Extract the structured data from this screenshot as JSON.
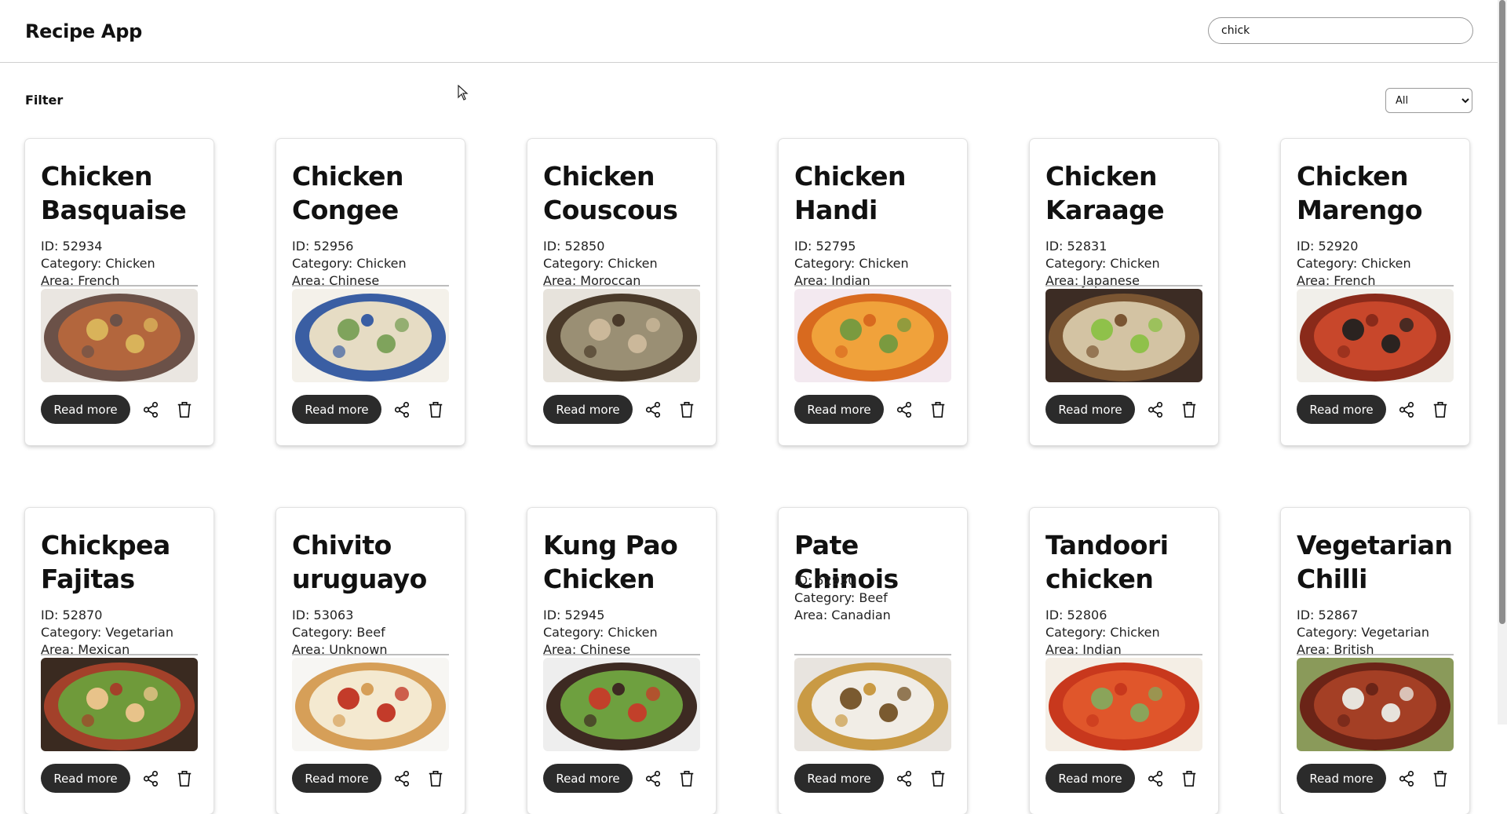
{
  "app": {
    "title": "Recipe App"
  },
  "search": {
    "value": "chick",
    "placeholder": ""
  },
  "filter": {
    "label": "Filter",
    "selected": "All",
    "options": [
      "All"
    ]
  },
  "recipes": [
    {
      "name": "Chicken Basquaise",
      "id": "ID: 52934",
      "category": "Category: Chicken",
      "area": "Area: French",
      "read_more": "Read more",
      "palette": [
        "#6b5148",
        "#b3663d",
        "#d9b35a",
        "#eae6e1"
      ]
    },
    {
      "name": "Chicken Congee",
      "id": "ID: 52956",
      "category": "Category: Chicken",
      "area": "Area: Chinese",
      "read_more": "Read more",
      "palette": [
        "#3a5ea3",
        "#e6dcc4",
        "#7fa35c",
        "#f4f1ea"
      ]
    },
    {
      "name": "Chicken Couscous",
      "id": "ID: 52850",
      "category": "Category: Chicken",
      "area": "Area: Moroccan",
      "read_more": "Read more",
      "palette": [
        "#4a3a2a",
        "#9a8f74",
        "#cbb89a",
        "#e7e3dc"
      ]
    },
    {
      "name": "Chicken Handi",
      "id": "ID: 52795",
      "category": "Category: Chicken",
      "area": "Area: Indian",
      "read_more": "Read more",
      "palette": [
        "#d86a1f",
        "#f0a23b",
        "#7a9a3f",
        "#f3e9f0"
      ]
    },
    {
      "name": "Chicken Karaage",
      "id": "ID: 52831",
      "category": "Category: Chicken",
      "area": "Area: Japanese",
      "read_more": "Read more",
      "palette": [
        "#7a5532",
        "#d3c3a3",
        "#8fc14a",
        "#3c2c24"
      ]
    },
    {
      "name": "Chicken Marengo",
      "id": "ID: 52920",
      "category": "Category: Chicken",
      "area": "Area: French",
      "read_more": "Read more",
      "palette": [
        "#8a2a1a",
        "#c8472b",
        "#2b2320",
        "#f1efea"
      ]
    },
    {
      "name": "Chickpea Fajitas",
      "id": "ID: 52870",
      "category": "Category: Vegetarian",
      "area": "Area: Mexican",
      "read_more": "Read more",
      "palette": [
        "#a3412a",
        "#6f9a3a",
        "#e8c38a",
        "#3a2a20"
      ]
    },
    {
      "name": "Chivito uruguayo",
      "id": "ID: 53063",
      "category": "Category: Beef",
      "area": "Area: Unknown",
      "read_more": "Read more",
      "palette": [
        "#d69f58",
        "#f4e9d0",
        "#c33b2a",
        "#f7f6f3"
      ]
    },
    {
      "name": "Kung Pao Chicken",
      "id": "ID: 52945",
      "category": "Category: Chicken",
      "area": "Area: Chinese",
      "read_more": "Read more",
      "palette": [
        "#3d2a22",
        "#6ea03f",
        "#c2402a",
        "#eeeeee"
      ]
    },
    {
      "name": "Pate Chinois",
      "id": "ID: 52930",
      "category": "Category: Beef",
      "area": "Area: Canadian",
      "read_more": "Read more",
      "palette": [
        "#c99a44",
        "#f1ede6",
        "#7a5a30",
        "#e8e4df"
      ]
    },
    {
      "name": "Tandoori chicken",
      "id": "ID: 52806",
      "category": "Category: Chicken",
      "area": "Area: Indian",
      "read_more": "Read more",
      "palette": [
        "#c8381d",
        "#e0562b",
        "#8aa45a",
        "#f4eee5"
      ]
    },
    {
      "name": "Vegetarian Chilli",
      "id": "ID: 52867",
      "category": "Category: Vegetarian",
      "area": "Area: British",
      "read_more": "Read more",
      "palette": [
        "#6b2417",
        "#a43f25",
        "#e7e3dc",
        "#8a9a5a"
      ]
    }
  ]
}
